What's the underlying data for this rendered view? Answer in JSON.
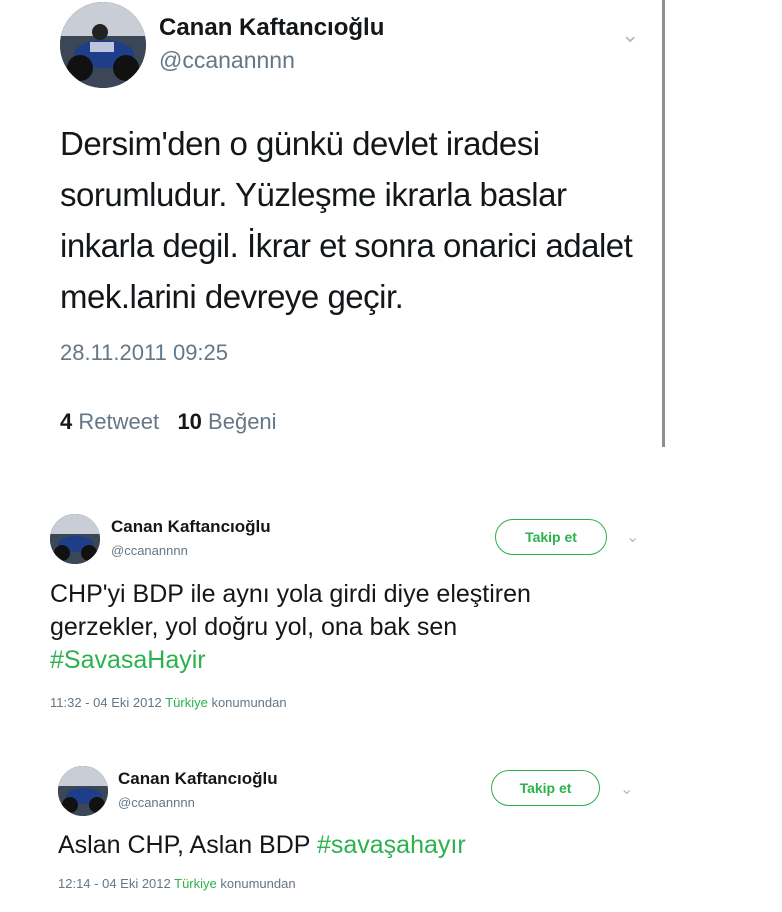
{
  "tweet1": {
    "name": "Canan Kaftancıoğlu",
    "handle": "@ccanannnn",
    "text_lines": [
      "Dersim'den o günkü devlet iradesi",
      "sorumludur. Yüzleşme ikrarla baslar",
      "inkarla degil. İkrar et sonra onarici adalet",
      "mek.larini devreye geçir."
    ],
    "timestamp": "28.11.2011 09:25",
    "retweet_count": "4",
    "retweet_label": "Retweet",
    "like_count": "10",
    "like_label": "Beğeni",
    "avatar_icon": "profile-photo",
    "menu_icon": "chevron-down-icon"
  },
  "tweet2": {
    "name": "Canan Kaftancıoğlu",
    "handle": "@ccanannnn",
    "follow_label": "Takip et",
    "text_line1": "CHP'yi BDP ile aynı yola girdi diye eleştiren",
    "text_line2": "gerzekler, yol doğru yol, ona bak sen",
    "hashtag": "#SavasaHayir",
    "time": "11:32 - 04 Eki 2012",
    "location": "Türkiye",
    "location_suffix": "konumundan"
  },
  "tweet3": {
    "name": "Canan Kaftancıoğlu",
    "handle": "@ccanannnn",
    "follow_label": "Takip et",
    "text": "Aslan CHP, Aslan BDP",
    "hashtag": "#savaşahayır",
    "time": "12:14 - 04 Eki 2012",
    "location": "Türkiye",
    "location_suffix": "konumundan"
  },
  "colors": {
    "accent_green": "#2bb24c",
    "secondary_text": "#657786",
    "primary_text": "#14171a"
  }
}
